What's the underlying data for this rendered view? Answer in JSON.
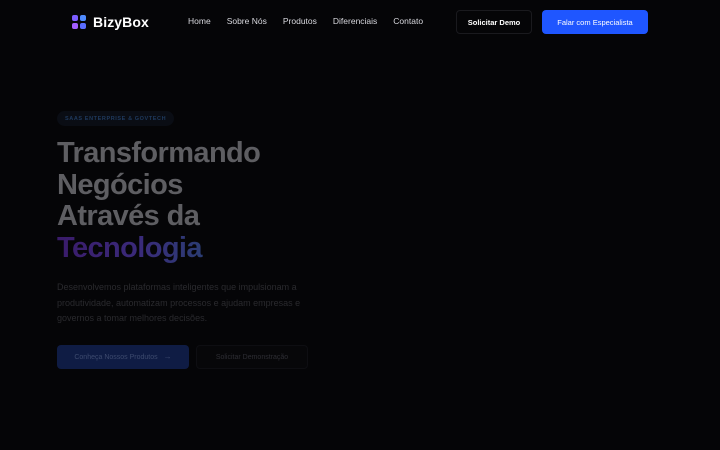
{
  "header": {
    "logo_text": "BizyBox",
    "nav": [
      "Home",
      "Sobre Nós",
      "Produtos",
      "Diferenciais",
      "Contato"
    ],
    "demo_button": "Solicitar Demo",
    "specialist_button": "Falar com Especialista"
  },
  "hero": {
    "badge": "SAAS ENTERPRISE & GOVTECH",
    "title_lines": [
      "Transformando",
      "Negócios",
      "Através da"
    ],
    "title_accent": "Tecnologia",
    "description": "Desenvolvemos plataformas inteligentes que impulsionam a produtividade, automatizam processos e ajudam empresas e governos a tomar melhores decisões.",
    "primary_button": "Conheça Nossos Produtos",
    "primary_button_icon": "arrow-right-icon",
    "secondary_button": "Solicitar Demonstração"
  },
  "colors": {
    "background": "#050507",
    "accent": "#1f56ff"
  }
}
